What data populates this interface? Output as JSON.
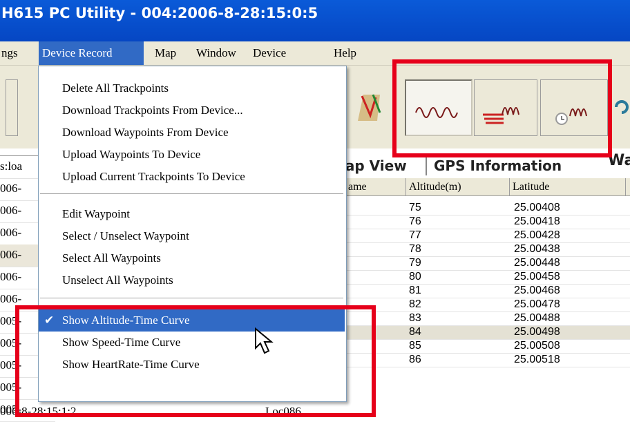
{
  "window": {
    "title": "H615 PC Utility - 004:2006-8-28:15:0:5"
  },
  "menubar": {
    "items": [
      "ngs",
      "Device Record",
      "Map",
      "Window",
      "Device",
      "Help"
    ],
    "active": "Device Record"
  },
  "toolbar": {
    "buttons": [
      "map-track-icon",
      "altitude-wave-icon",
      "speed-wave-icon",
      "heartrate-clock-icon",
      "refresh-icon"
    ]
  },
  "tabs": {
    "map_view": "Map View",
    "gps_information": "GPS Information",
    "more": "Wa"
  },
  "leftpane": {
    "header": "s:loa",
    "rows": [
      "006-",
      "006-",
      "006-",
      "006-",
      "006-",
      "006-",
      "005-",
      "005-",
      "005-",
      "005-",
      "005-"
    ],
    "bottom_date": "006-8-28:15:1:2",
    "bottom_name": "Loc086"
  },
  "grid": {
    "columns": [
      "ame",
      "Altitude(m)",
      "Latitude"
    ],
    "rows": [
      {
        "alt": "75",
        "lat": "25.00408"
      },
      {
        "alt": "76",
        "lat": "25.00418"
      },
      {
        "alt": "77",
        "lat": "25.00428"
      },
      {
        "alt": "78",
        "lat": "25.00438"
      },
      {
        "alt": "79",
        "lat": "25.00448"
      },
      {
        "alt": "80",
        "lat": "25.00458"
      },
      {
        "alt": "81",
        "lat": "25.00468"
      },
      {
        "alt": "82",
        "lat": "25.00478"
      },
      {
        "alt": "83",
        "lat": "25.00488"
      },
      {
        "alt": "84",
        "lat": "25.00498"
      },
      {
        "alt": "85",
        "lat": "25.00508"
      },
      {
        "alt": "86",
        "lat": "25.00518"
      }
    ]
  },
  "dropdown": {
    "items": [
      "Delete All Trackpoints",
      "Download Trackpoints From Device...",
      "Download Waypoints From Device",
      "Upload Waypoints To Device",
      "Upload Current Trackpoints To Device",
      "Edit Waypoint",
      "Select / Unselect Waypoint",
      "Select All Waypoints",
      "Unselect All Waypoints",
      "Show Altitude-Time Curve",
      "Show Speed-Time Curve",
      "Show HeartRate-Time Curve"
    ],
    "checked_item": "Show Altitude-Time Curve",
    "check_mark": "✔"
  },
  "colors": {
    "highlight": "#316ac5",
    "annotation": "#e6001a",
    "titlebar": "#0a5ad8"
  }
}
